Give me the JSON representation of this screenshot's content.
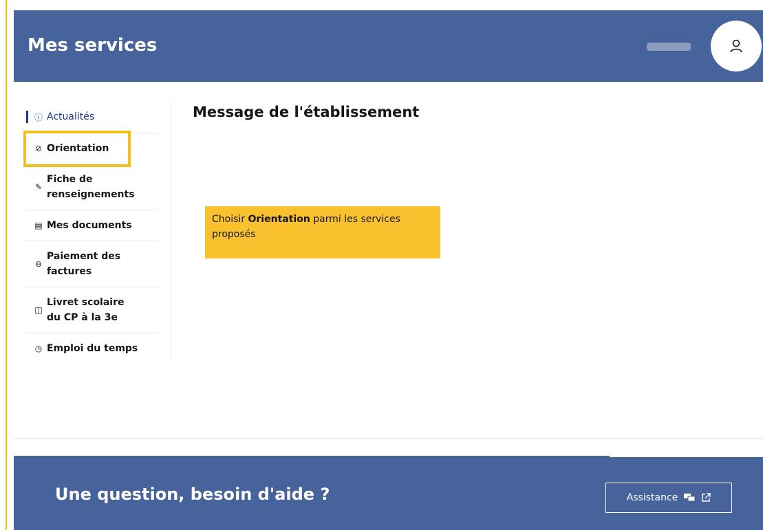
{
  "header": {
    "title": "Mes services"
  },
  "sidebar": {
    "items": [
      {
        "label": "Actualités",
        "icon": "info-icon"
      },
      {
        "label": "Orientation",
        "icon": "compass-icon"
      },
      {
        "label": "Fiche de renseignements",
        "icon": "edit-icon"
      },
      {
        "label": "Mes documents",
        "icon": "documents-icon"
      },
      {
        "label": "Paiement des factures",
        "icon": "payment-icon"
      },
      {
        "label": "Livret scolaire du CP à la 3e",
        "icon": "book-icon"
      },
      {
        "label": "Emploi du temps",
        "icon": "clock-icon"
      }
    ]
  },
  "main": {
    "title": "Message de l'établissement"
  },
  "callout": {
    "prefix": "Choisir ",
    "bold": "Orientation",
    "suffix": " parmi les services proposés"
  },
  "footer": {
    "title": "Une question, besoin d'aide ?",
    "assistance_label": "Assistance"
  },
  "colors": {
    "header_bg": "#46649b",
    "highlight": "#f2c01e",
    "callout_bg": "#f9c12e",
    "active": "#1e3a8a"
  }
}
